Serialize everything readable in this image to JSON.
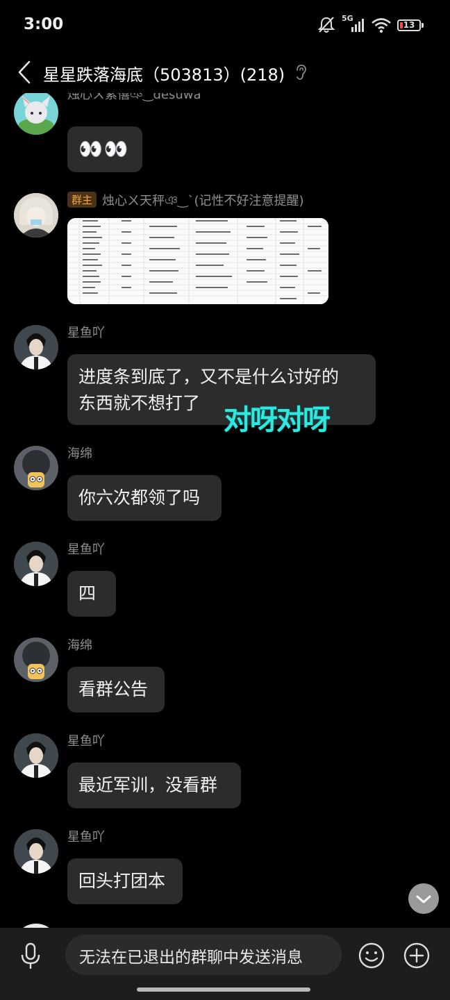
{
  "status": {
    "time": "3:00",
    "network": "5G",
    "battery_level": "13"
  },
  "header": {
    "title": "星星跌落海底（503813）(218)"
  },
  "messages": [
    {
      "sender": "烛心ㄨ紫僖ঞ‿desuwa",
      "text": "👀👀"
    },
    {
      "badge": "群主",
      "sender": "烛心ㄨ天秤ঞ‿`(记性不好注意提醒)"
    },
    {
      "sender": "星鱼吖",
      "text_lines": [
        "进度条到底了，又不是什么讨好的",
        "东西就不想打了"
      ]
    },
    {
      "sender": "海绵",
      "text": "你六次都领了吗"
    },
    {
      "sender": "星鱼吖",
      "text": "四"
    },
    {
      "sender": "海绵",
      "text": "看群公告"
    },
    {
      "sender": "星鱼吖",
      "text": "最近军训，没看群"
    },
    {
      "sender": "星鱼吖",
      "text": "回头打团本"
    }
  ],
  "overlay_text": "对呀对呀",
  "bottom": {
    "input_text": "无法在已退出的群聊中发送消息"
  },
  "colors": {
    "background": "#000000",
    "bubble": "#2c2c2c",
    "overlay": "#2ee9e0",
    "badge": "#f0a640"
  },
  "icons": [
    "back-arrow-icon",
    "ear-icon",
    "mute-icon",
    "signal-icon",
    "wifi-icon",
    "battery-icon",
    "microphone-icon",
    "smiley-icon",
    "plus-icon",
    "chevron-down-icon"
  ]
}
